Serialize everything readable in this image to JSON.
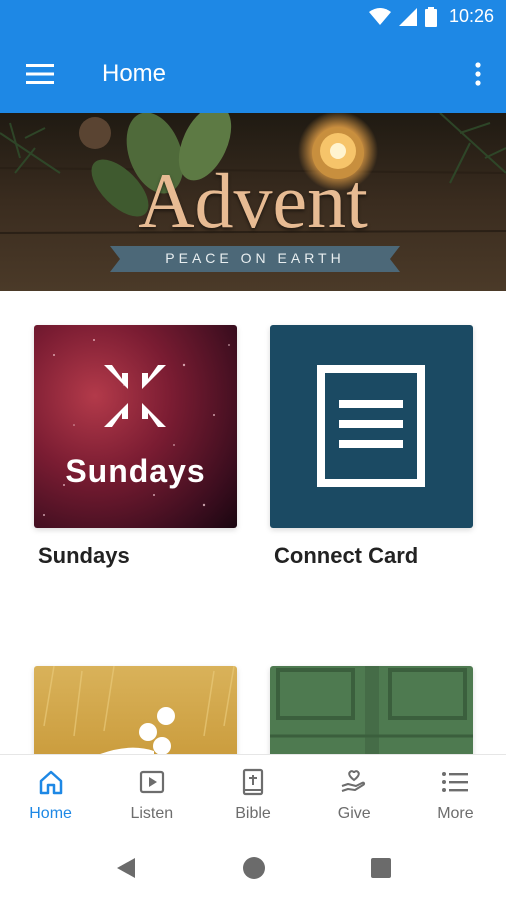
{
  "status_bar": {
    "time": "10:26"
  },
  "app_bar": {
    "title": "Home",
    "background": "#1e88e5"
  },
  "banner": {
    "title": "Advent",
    "subtitle": "PEACE ON EARTH"
  },
  "cards": [
    {
      "label": "Sundays",
      "image_text": "Sundays"
    },
    {
      "label": "Connect Card"
    },
    {
      "label": ""
    },
    {
      "label": ""
    }
  ],
  "bottom_nav": {
    "items": [
      {
        "label": "Home",
        "icon": "home-icon",
        "active": true
      },
      {
        "label": "Listen",
        "icon": "play-icon",
        "active": false
      },
      {
        "label": "Bible",
        "icon": "bible-icon",
        "active": false
      },
      {
        "label": "Give",
        "icon": "give-icon",
        "active": false
      },
      {
        "label": "More",
        "icon": "list-icon",
        "active": false
      }
    ],
    "active_color": "#1e88e5",
    "inactive_color": "#6d6d6d"
  }
}
